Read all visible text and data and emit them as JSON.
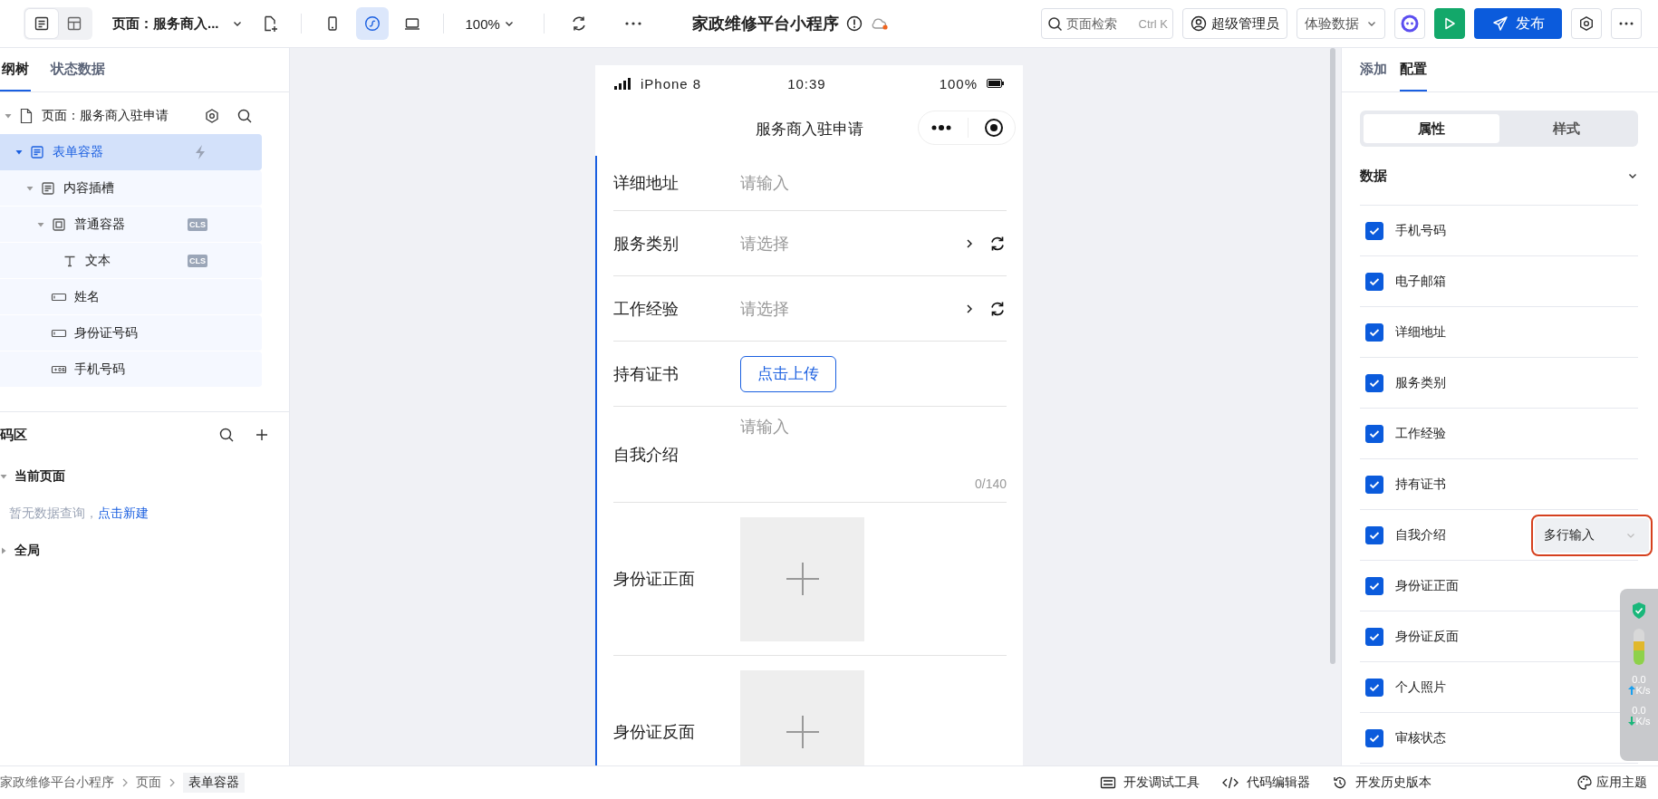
{
  "toolbar": {
    "view_toggles": [
      {
        "kind": "outline",
        "selected": true
      },
      {
        "kind": "layout",
        "selected": false
      }
    ],
    "page_selector": "页面：服务商入...",
    "devices": [
      {
        "kind": "phone",
        "selected": false
      },
      {
        "kind": "miniprogram",
        "selected": true
      },
      {
        "kind": "desktop",
        "selected": false
      }
    ],
    "zoom": "100%",
    "app_title": "家政维修平台小程序",
    "search": {
      "placeholder": "页面检索",
      "shortcut": "Ctrl K"
    },
    "user": "超级管理员",
    "data_mode": "体验数据",
    "publish": "发布"
  },
  "left_panel": {
    "tabs": [
      {
        "label": "纲树",
        "selected": true
      },
      {
        "label": "状态数据",
        "selected": false
      }
    ],
    "tree": [
      {
        "label": "页面：服务商入驻申请",
        "kind": "page",
        "expanded": true,
        "selected": false,
        "children": [
          {
            "label": "表单容器",
            "kind": "form",
            "expanded": true,
            "selected": true,
            "children": [
              {
                "label": "内容插槽",
                "kind": "form",
                "expanded": true,
                "selected": false,
                "children": [
                  {
                    "label": "普通容器",
                    "kind": "container",
                    "expanded": true,
                    "selected": false,
                    "badge": "CLS",
                    "children": [
                      {
                        "label": "文本",
                        "kind": "text",
                        "selected": false,
                        "badge": "CLS"
                      }
                    ]
                  },
                  {
                    "label": "姓名",
                    "kind": "input",
                    "selected": false
                  },
                  {
                    "label": "身份证号码",
                    "kind": "input",
                    "selected": false
                  },
                  {
                    "label": "手机号码",
                    "kind": "phone",
                    "selected": false
                  }
                ]
              }
            ]
          }
        ]
      }
    ],
    "code_area": {
      "title": "码区",
      "sections": [
        {
          "label": "当前页面",
          "expanded": true,
          "empty_text": "暂无数据查询，",
          "link": "点击新建"
        },
        {
          "label": "全局",
          "expanded": false
        }
      ]
    }
  },
  "phone": {
    "carrier": "iPhone 8",
    "time": "10:39",
    "battery": "100%",
    "title": "服务商入驻申请",
    "fields": [
      {
        "kind": "input",
        "label": "详细地址",
        "placeholder": "请输入"
      },
      {
        "kind": "select",
        "label": "服务类别",
        "placeholder": "请选择"
      },
      {
        "kind": "select",
        "label": "工作经验",
        "placeholder": "请选择"
      },
      {
        "kind": "upload",
        "label": "持有证书",
        "button": "点击上传"
      },
      {
        "kind": "textarea",
        "label": "自我介绍",
        "placeholder": "请输入",
        "counter": "0/140"
      },
      {
        "kind": "image",
        "label": "身份证正面"
      },
      {
        "kind": "image",
        "label": "身份证反面"
      }
    ]
  },
  "right_panel": {
    "tabs": [
      {
        "label": "添加",
        "selected": false
      },
      {
        "label": "配置",
        "selected": true
      }
    ],
    "segments": [
      {
        "label": "属性",
        "selected": true
      },
      {
        "label": "样式",
        "selected": false
      }
    ],
    "section": {
      "title": "数据",
      "expanded": true
    },
    "fields": [
      {
        "label": "手机号码",
        "checked": true
      },
      {
        "label": "电子邮箱",
        "checked": true
      },
      {
        "label": "详细地址",
        "checked": true
      },
      {
        "label": "服务类别",
        "checked": true
      },
      {
        "label": "工作经验",
        "checked": true
      },
      {
        "label": "持有证书",
        "checked": true
      },
      {
        "label": "自我介绍",
        "checked": true,
        "type": "多行输入",
        "highlighted": true
      },
      {
        "label": "身份证正面",
        "checked": true
      },
      {
        "label": "身份证反面",
        "checked": true
      },
      {
        "label": "个人照片",
        "checked": true
      },
      {
        "label": "审核状态",
        "checked": true
      }
    ]
  },
  "bottom_bar": {
    "breadcrumb": [
      "家政维修平台小程序",
      "页面",
      "表单容器"
    ],
    "tools": [
      {
        "kind": "debug",
        "label": "开发调试工具"
      },
      {
        "kind": "code",
        "label": "代码编辑器"
      },
      {
        "kind": "history",
        "label": "开发历史版本"
      }
    ],
    "theme": "应用主题"
  },
  "net_widget": {
    "speeds": [
      {
        "kind": "up",
        "value": "0.0",
        "unit": "K/s"
      },
      {
        "kind": "down",
        "value": "0.0",
        "unit": "K/s"
      }
    ]
  }
}
